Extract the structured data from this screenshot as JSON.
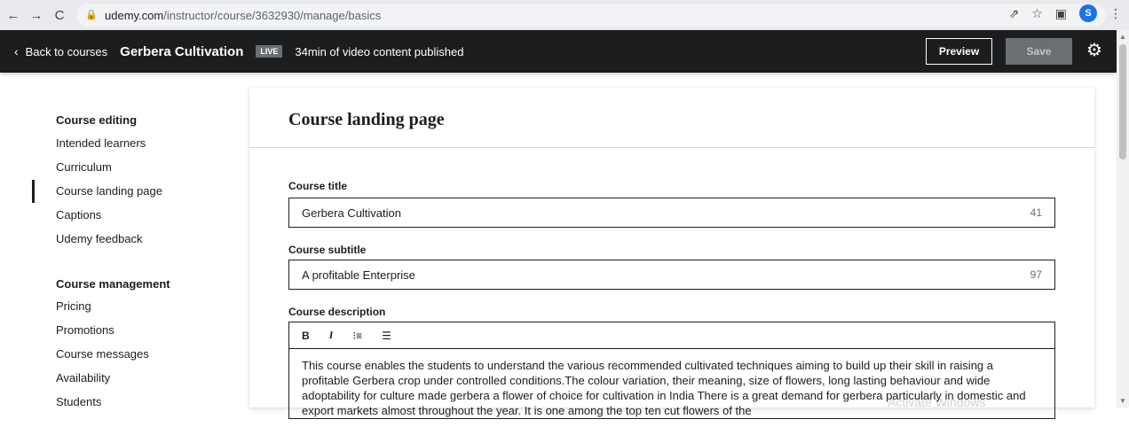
{
  "browser": {
    "url_host": "udemy.com",
    "url_path": "/instructor/course/3632930/manage/basics",
    "profile_initial": "S"
  },
  "header": {
    "back_label": "Back to courses",
    "course_title": "Gerbera Cultivation",
    "live_badge": "LIVE",
    "published_text": "34min of video content published",
    "preview_label": "Preview",
    "save_label": "Save"
  },
  "sidebar": {
    "section1_heading": "Course editing",
    "section1_items": [
      "Intended learners",
      "Curriculum",
      "Course landing page",
      "Captions",
      "Udemy feedback"
    ],
    "section2_heading": "Course management",
    "section2_items": [
      "Pricing",
      "Promotions",
      "Course messages",
      "Availability",
      "Students"
    ]
  },
  "main": {
    "page_title": "Course landing page",
    "title_label": "Course title",
    "title_value": "Gerbera Cultivation",
    "title_count": "41",
    "subtitle_label": "Course subtitle",
    "subtitle_value": "A profitable Enterprise",
    "subtitle_count": "97",
    "description_label": "Course description",
    "toolbar": {
      "bold": "B",
      "italic": "I",
      "ordered": "⁝≡",
      "bullets": "☰"
    },
    "description_text": "This course enables the students to understand the various recommended cultivated techniques aiming to build up their skill in raising a profitable Gerbera crop under controlled conditions.The colour variation, their meaning, size of flowers, long lasting behaviour and wide adoptability for culture made gerbera a flower of choice for cultivation in India  There is a great demand for gerbera particularly in domestic and export markets almost throughout the year. It is one among the top ten cut flowers of the"
  },
  "watermark": "Activate Windows"
}
